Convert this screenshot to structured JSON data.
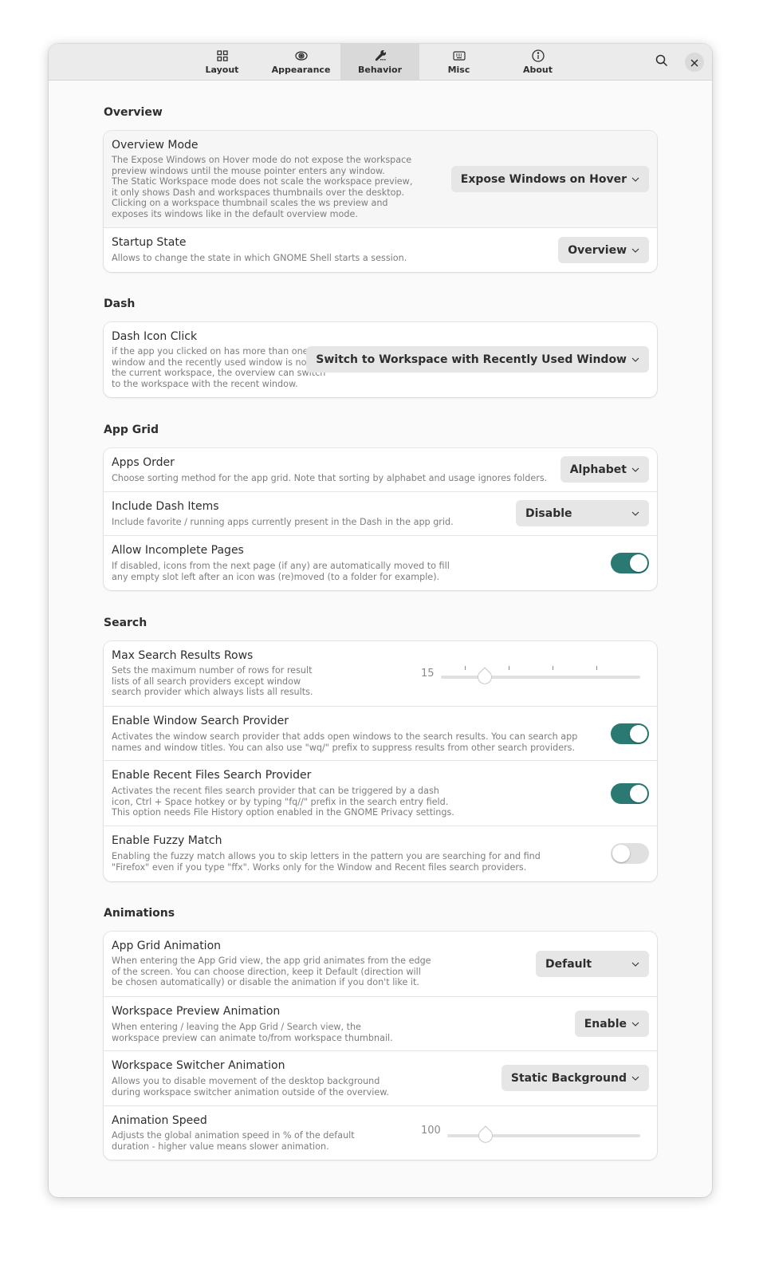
{
  "header": {
    "tabs": [
      {
        "label": "Layout",
        "icon": "grid-icon",
        "active": false
      },
      {
        "label": "Appearance",
        "icon": "eye-icon",
        "active": false
      },
      {
        "label": "Behavior",
        "icon": "wrench-icon",
        "active": true
      },
      {
        "label": "Misc",
        "icon": "keyboard-icon",
        "active": false
      },
      {
        "label": "About",
        "icon": "info-icon",
        "active": false
      }
    ],
    "search_icon": "search-icon",
    "close_icon": "close-icon"
  },
  "colors": {
    "accent": "#2a7a73",
    "switch_off": "#e0e0e0",
    "dropdown_bg": "#e6e6e6"
  },
  "sections": {
    "overview": {
      "title": "Overview",
      "rows": [
        {
          "title": "Overview Mode",
          "description": "The Expose Windows on Hover mode do not expose the workspace\npreview windows until the mouse pointer enters any window.\nThe Static Workspace mode does not scale the workspace preview,\nit only shows Dash and workspaces thumbnails over the desktop.\nClicking on a workspace thumbnail scales the ws preview and\nexposes its windows like in the default overview mode.",
          "value": "Expose Windows on Hover"
        },
        {
          "title": "Startup State",
          "description": "Allows to change the state in which GNOME Shell starts a session.",
          "value": "Overview"
        }
      ]
    },
    "dash": {
      "title": "Dash",
      "rows": [
        {
          "title": "Dash Icon Click",
          "description": "if the app you clicked on has more than one\nwindow and the recently used window is not on\nthe current workspace, the overview can switch\nto the workspace with the recent window.",
          "value": "Switch to Workspace with Recently Used Window"
        }
      ]
    },
    "app_grid": {
      "title": "App Grid",
      "rows": [
        {
          "title": "Apps Order",
          "description": "Choose sorting method for the app grid. Note that sorting by alphabet and usage ignores folders.",
          "value": "Alphabet"
        },
        {
          "title": "Include Dash Items",
          "description": "Include favorite / running apps currently present in the Dash in the app grid.",
          "value": "Disable"
        },
        {
          "title": "Allow Incomplete Pages",
          "description": "If disabled, icons from the next page (if any) are automatically moved to fill\nany empty slot left after an icon was (re)moved (to a folder for example).",
          "enabled": true
        }
      ]
    },
    "search": {
      "title": "Search",
      "rows": [
        {
          "title": "Max Search Results Rows",
          "description": "Sets the maximum number of rows for result\nlists of all search providers except window\nsearch provider which always lists all results.",
          "value": "15",
          "slider_fraction": 0.22
        },
        {
          "title": "Enable Window Search Provider",
          "description": "Activates the window search provider that adds open windows to the search results. You can search app\nnames and window titles. You can also use \"wq/\" prefix to suppress results from other search providers.",
          "enabled": true
        },
        {
          "title": "Enable Recent Files Search Provider",
          "description": "Activates the recent files search provider that can be triggered by a dash\nicon, Ctrl + Space hotkey or by typing \"fq//\" prefix in the search entry field.\nThis option needs File History option enabled in the GNOME Privacy settings.",
          "enabled": true
        },
        {
          "title": "Enable Fuzzy Match",
          "description": "Enabling the fuzzy match allows you to skip letters in the pattern you are searching for and find\n\"Firefox\" even if you type \"ffx\". Works only for the Window and Recent files search providers.",
          "enabled": false
        }
      ]
    },
    "animations": {
      "title": "Animations",
      "rows": [
        {
          "title": "App Grid Animation",
          "description": "When entering the App Grid view, the app grid animates from the edge\nof the screen. You can choose direction, keep it Default (direction will\nbe chosen automatically) or disable the animation if you don't like it.",
          "value": "Default"
        },
        {
          "title": "Workspace Preview Animation",
          "description": "When entering / leaving the App Grid / Search view, the\nworkspace preview can animate to/from workspace thumbnail.",
          "value": "Enable"
        },
        {
          "title": "Workspace Switcher Animation",
          "description": "Allows you to disable movement of the desktop background\nduring workspace switcher animation outside of the overview.",
          "value": "Static Background"
        },
        {
          "title": "Animation Speed",
          "description": "Adjusts the global animation speed in % of the default\nduration - higher value means slower animation.",
          "value": "100",
          "slider_fraction": 0.2
        }
      ]
    }
  }
}
